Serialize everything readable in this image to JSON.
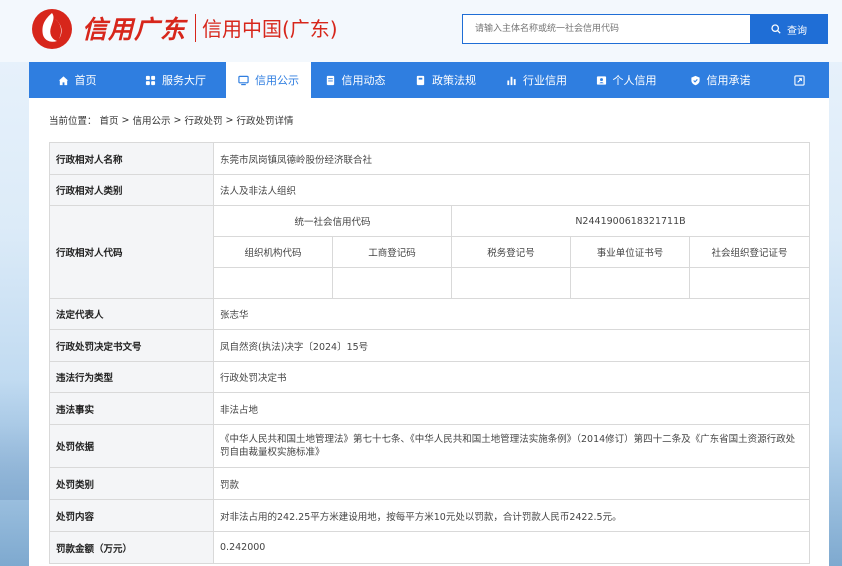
{
  "header": {
    "logo_script": "信用广东",
    "site_name": "信用中国(广东)",
    "search": {
      "placeholder": "请输入主体名称或统一社会信用代码",
      "button": "查询"
    }
  },
  "nav": [
    {
      "label": "首页",
      "icon": "home-icon"
    },
    {
      "label": "服务大厅",
      "icon": "grid-icon"
    },
    {
      "label": "信用公示",
      "icon": "monitor-icon",
      "active": true
    },
    {
      "label": "信用动态",
      "icon": "document-icon"
    },
    {
      "label": "政策法规",
      "icon": "book-icon"
    },
    {
      "label": "行业信用",
      "icon": "bar-chart-icon"
    },
    {
      "label": "个人信用",
      "icon": "person-card-icon"
    },
    {
      "label": "信用承诺",
      "icon": "shield-check-icon"
    },
    {
      "label": "",
      "icon": "expand-icon"
    }
  ],
  "breadcrumb": {
    "prefix": "当前位置：",
    "items": [
      "首页",
      "信用公示",
      "行政处罚",
      "行政处罚详情"
    ],
    "sep": ">"
  },
  "detail": {
    "name_label": "行政相对人名称",
    "name_value": "东莞市凤岗镇凤德岭股份经济联合社",
    "type_label": "行政相对人类别",
    "type_value": "法人及非法人组织",
    "code_label": "行政相对人代码",
    "uscc_label": "统一社会信用代码",
    "uscc_value": "N2441900618321711B",
    "sub_headers": [
      "组织机构代码",
      "工商登记码",
      "税务登记号",
      "事业单位证书号",
      "社会组织登记证号"
    ],
    "sub_values": [
      "",
      "",
      "",
      "",
      ""
    ],
    "legal_rep_label": "法定代表人",
    "legal_rep_value": "张志华",
    "doc_no_label": "行政处罚决定书文号",
    "doc_no_value": "凤自然资(执法)决字〔2024〕15号",
    "violation_type_label": "违法行为类型",
    "violation_type_value": "行政处罚决定书",
    "facts_label": "违法事实",
    "facts_value": "非法占地",
    "basis_label": "处罚依据",
    "basis_value": "《中华人民共和国土地管理法》第七十七条、《中华人民共和国土地管理法实施条例》（2014修订）第四十二条及《广东省国土资源行政处罚自由裁量权实施标准》",
    "category_label": "处罚类别",
    "category_value": "罚款",
    "content_label": "处罚内容",
    "content_value": "对非法占用的242.25平方米建设用地，按每平方米10元处以罚款，合计罚款人民币2422.5元。",
    "amount_label": "罚款金额（万元）",
    "amount_value": "0.242000"
  }
}
